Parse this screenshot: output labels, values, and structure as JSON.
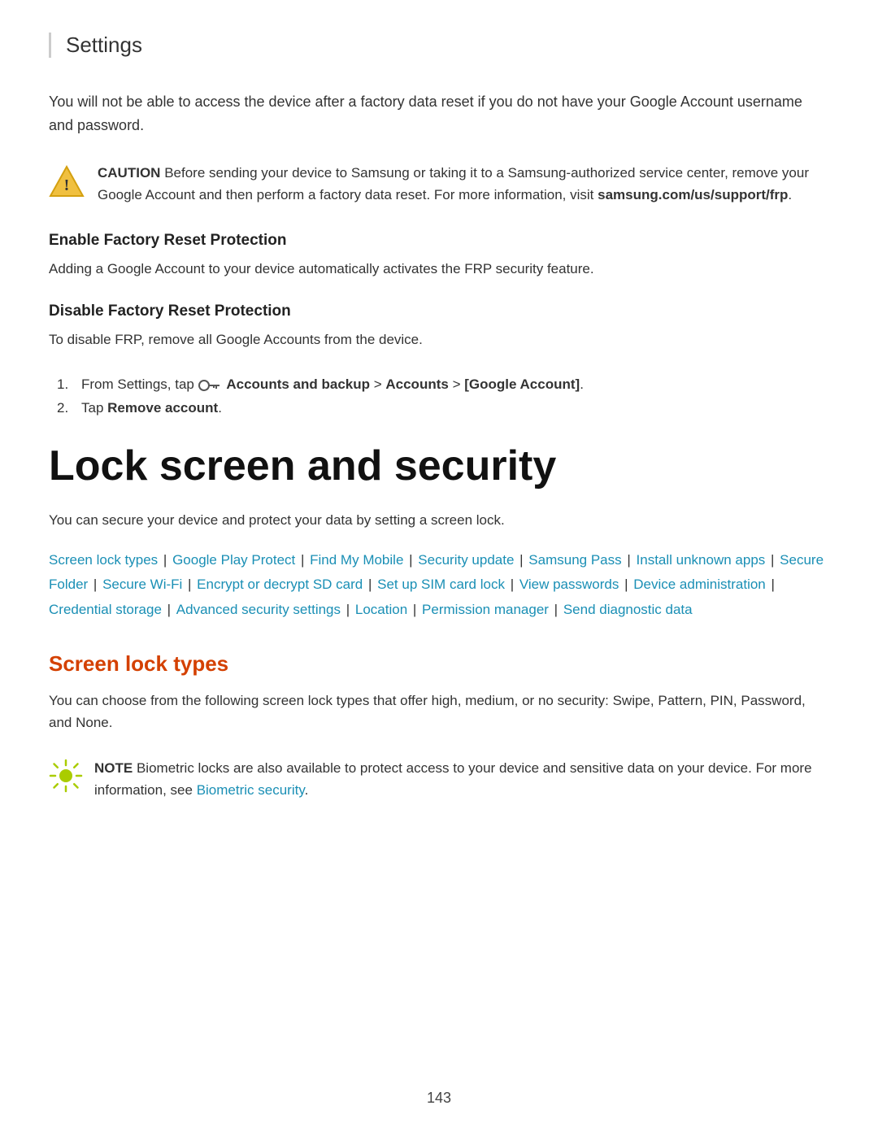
{
  "header": {
    "title": "Settings"
  },
  "intro": {
    "text": "You will not be able to access the device after a factory data reset if you do not have your Google Account username and password."
  },
  "caution": {
    "label": "CAUTION",
    "text": " Before sending your device to Samsung or taking it to a Samsung-authorized service center, remove your Google Account and then perform a factory data reset. For more information, visit ",
    "link": "samsung.com/us/support/frp",
    "end": "."
  },
  "enable_section": {
    "heading": "Enable Factory Reset Protection",
    "text": "Adding a Google Account to your device automatically activates the FRP security feature."
  },
  "disable_section": {
    "heading": "Disable Factory Reset Protection",
    "text": "To disable FRP, remove all Google Accounts from the device.",
    "steps": [
      {
        "num": "1.",
        "text_before": "From Settings, tap ",
        "icon": "key",
        "link_text": "Accounts and backup",
        "text_after": " > Accounts > [Google Account]."
      },
      {
        "num": "2.",
        "text_before": "Tap ",
        "bold_text": "Remove account",
        "text_after": "."
      }
    ]
  },
  "chapter": {
    "title": "Lock screen and security",
    "intro": "You can secure your device and protect your data by setting a screen lock."
  },
  "links": {
    "items": [
      "Screen lock types",
      "Google Play Protect",
      "Find My Mobile",
      "Security update",
      "Samsung Pass",
      "Install unknown apps",
      "Secure Folder",
      "Secure Wi-Fi",
      "Encrypt or decrypt SD card",
      "Set up SIM card lock",
      "View passwords",
      "Device administration",
      "Credential storage",
      "Advanced security settings",
      "Location",
      "Permission manager",
      "Send diagnostic data"
    ]
  },
  "screen_lock_types": {
    "title": "Screen lock types",
    "text": "You can choose from the following screen lock types that offer high, medium, or no security: Swipe, Pattern, PIN, Password, and None."
  },
  "note": {
    "label": "NOTE",
    "text": " Biometric locks are also available to protect access to your device and sensitive data on your device. For more information, see ",
    "link_text": "Biometric security",
    "end": "."
  },
  "footer": {
    "page_number": "143"
  }
}
